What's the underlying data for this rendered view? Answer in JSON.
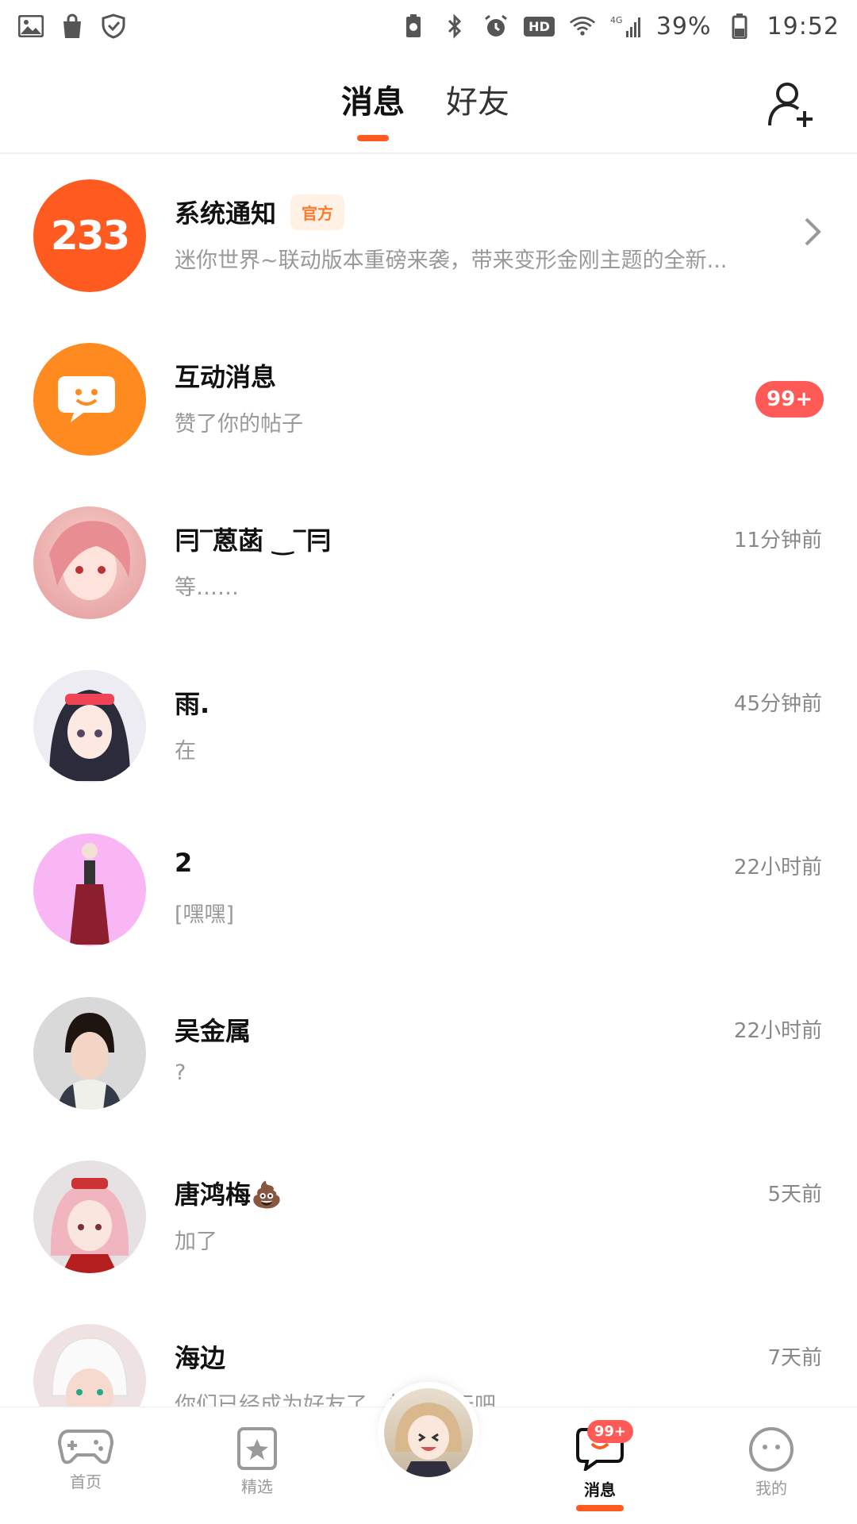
{
  "status_bar": {
    "battery_percent": "39%",
    "time": "19:52",
    "hd_label": "HD",
    "network_label": "4G",
    "left_icons": [
      "image-icon",
      "shopping-bag-icon",
      "shield-icon"
    ],
    "right_icons": [
      "battery-saver-icon",
      "bluetooth-icon",
      "alarm-icon",
      "hd-icon",
      "wifi-icon",
      "signal-icon",
      "battery-icon"
    ]
  },
  "header": {
    "tabs": [
      {
        "label": "消息",
        "active": true
      },
      {
        "label": "好友",
        "active": false
      }
    ],
    "add_friend_icon": "add-user-icon"
  },
  "messages": [
    {
      "name": "系统通知",
      "tag": "官方",
      "preview": "迷你世界~联动版本重磅来袭，带来变形金刚主题的全新...",
      "time": "",
      "avatar_text": "233",
      "avatar_color": "#ff5a1f",
      "type": "system"
    },
    {
      "name": "互动消息",
      "preview": "赞了你的帖子",
      "time": "",
      "badge": "99+",
      "avatar_color": "#ff8a1f",
      "type": "interaction"
    },
    {
      "name": "冃‾蒽菡 ‿‾冃",
      "preview": "等……",
      "time": "11分钟前",
      "avatar_color": "#f2b7b5",
      "type": "user"
    },
    {
      "name": "雨.",
      "preview": "在",
      "time": "45分钟前",
      "avatar_color": "#3a3a4a",
      "type": "user"
    },
    {
      "name": "2",
      "preview": "[嘿嘿]",
      "time": "22小时前",
      "avatar_color": "#f9b6f5",
      "type": "user"
    },
    {
      "name": "吴金属",
      "preview": "?",
      "time": "22小时前",
      "avatar_color": "#d9d9d9",
      "type": "user"
    },
    {
      "name": "唐鸿梅💩",
      "preview": "加了",
      "time": "5天前",
      "avatar_color": "#f3c8cf",
      "type": "user"
    },
    {
      "name": "海边",
      "preview": "你们已经成为好友了，快来聊天吧",
      "time": "7天前",
      "avatar_color": "#e8d8d8",
      "type": "user"
    }
  ],
  "bottom_nav": {
    "items": [
      {
        "label": "首页",
        "icon": "gamepad-icon"
      },
      {
        "label": "精选",
        "icon": "star-card-icon"
      },
      {
        "label": "",
        "icon": "avatar-center"
      },
      {
        "label": "消息",
        "icon": "chat-bubble-icon",
        "badge": "99+",
        "active": true
      },
      {
        "label": "我的",
        "icon": "face-icon"
      }
    ]
  },
  "colors": {
    "accent": "#ff5a1f",
    "badge": "#ff5a55"
  }
}
